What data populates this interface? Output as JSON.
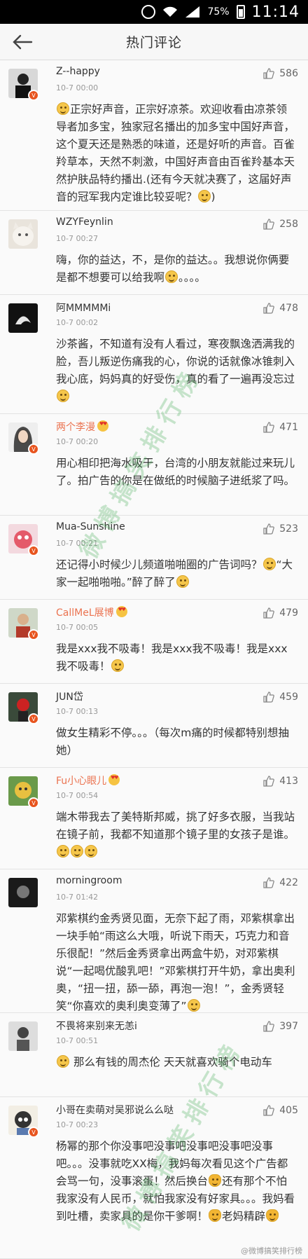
{
  "status_bar": {
    "battery": "75%",
    "time": "11:14"
  },
  "header": {
    "title": "热门评论",
    "back_icon": "arrow-left-icon"
  },
  "watermark": {
    "text": "微博搞笑排行榜",
    "footer": "@微博搞笑排行榜"
  },
  "comments": [
    {
      "user": "Z--happy",
      "time": "10-7 00:00",
      "likes": "586",
      "verified": true,
      "vip": false,
      "text": "正宗好声音，正宗好凉茶。欢迎收看由凉茶领导者加多宝，独家冠名播出的加多宝中国好声音，这个夏天还是熟悉的味道，还是好听的声音。百雀羚草本，天然不刺激，中国好声音由百雀羚基本天然护肤品特约播出.(还有今天就决赛了，这届好声音的冠军我内定谁比较妥呢？"
    },
    {
      "user": "WZYFeynlin",
      "time": "10-7 00:27",
      "likes": "258",
      "verified": false,
      "vip": false,
      "text": "嗨，你的益达，不，是你的益达。。我想说你俩要是都不想要可以给我啊",
      "tail": "。。。。"
    },
    {
      "user": "阿MMMMMi",
      "time": "10-7 00:02",
      "likes": "478",
      "verified": false,
      "vip": false,
      "text": "沙茶酱，不知道有没有人看过，寒夜飘逸洒满我的脸，吾儿叛逆伤痛我的心，你说的话就像冰锥刺入我心底，妈妈真的好受伤，真的看了一遍再没忘过"
    },
    {
      "user": "两个李漫",
      "time": "10-7 00:20",
      "likes": "471",
      "verified": true,
      "vip": true,
      "text": "用心相印把海水吸干，台湾的小朋友就能过来玩儿了。拍广告的你是在做纸的时候脑子进纸浆了吗。"
    },
    {
      "user": "Mua-Sunshine",
      "time": "10-7 00:21",
      "likes": "523",
      "verified": true,
      "vip": false,
      "text": "还记得小时候少儿频道啪啪圈的广告词吗？",
      "text2": "“大家一起啪啪啪。”醉了醉了"
    },
    {
      "user": "CallMeL展博",
      "time": "10-7 00:05",
      "likes": "479",
      "verified": true,
      "vip": true,
      "text": "我是xxx我不吸毒！我是xxx我不吸毒！我是xxx我不吸毒！"
    },
    {
      "user": "JUN岱",
      "time": "10-7 00:13",
      "likes": "459",
      "verified": true,
      "vip": false,
      "text": "做女生精彩不停。。。（每次m痛的时候都特别想抽她）"
    },
    {
      "user": "Fu小心眼儿",
      "time": "10-7 00:54",
      "likes": "413",
      "verified": true,
      "vip": true,
      "text": "端木带我去了美特斯邦威，挑了好多衣服，当我站在镜子前，我都不知道那个镜子里的女孩子是谁。"
    },
    {
      "user": "morningroom",
      "time": "10-7 01:42",
      "likes": "422",
      "verified": false,
      "vip": false,
      "text": "邓紫棋约金秀贤见面，无奈下起了雨，邓紫棋拿出一块手帕“雨这么大哦，听说下雨天，巧克力和音乐很配！”然后金秀贤拿出两盒牛奶，对邓紫棋说“一起喝优酸乳吧！”邓紫棋打开牛奶，拿出奥利奥，“扭一扭，舔一舔，再泡一泡！”，金秀贤轻笑“你喜欢的奥利奥变薄了”"
    },
    {
      "user": "不畏将来别来无恙i",
      "time": "10-7 00:51",
      "likes": "397",
      "verified": false,
      "vip": false,
      "text": "那么有钱的周杰伦 天天就喜欢骑个电动车"
    },
    {
      "user": "小哥在卖萌对吴邪说么么哒",
      "time": "10-7 00:23",
      "likes": "405",
      "verified": true,
      "vip": false,
      "text": "杨幂的那个你没事吧没事吧没事吧没事吧没事吧。。。没事就吃XX梅，我妈每次看见这个广告都会骂一句，没事滚蛋！然后换台",
      "text2": "还有那个不怕我家没有人民币，就怕我家没有好家具。。。我妈看到吐槽，卖家具的是你干爹啊！",
      "text3": "老妈精辟"
    }
  ]
}
